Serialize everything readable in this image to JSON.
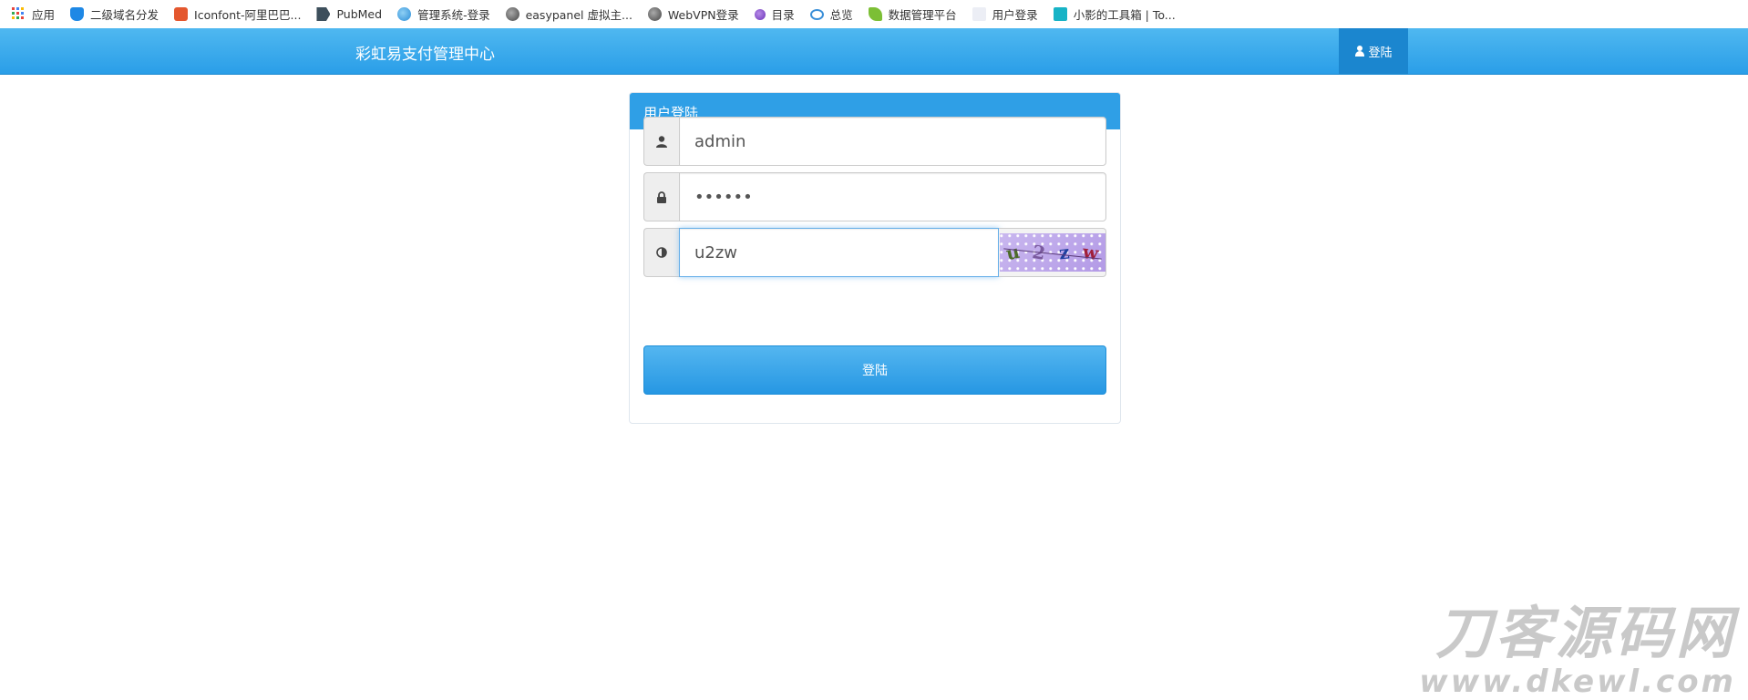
{
  "bookmarks": [
    {
      "label": "应用",
      "icon": "apps-grid-icon"
    },
    {
      "label": "二级域名分发",
      "icon": "shield-icon"
    },
    {
      "label": "Iconfont-阿里巴巴...",
      "icon": "iconfont-icon"
    },
    {
      "label": "PubMed",
      "icon": "pubmed-icon"
    },
    {
      "label": "管理系统-登录",
      "icon": "globe-icon"
    },
    {
      "label": "easypanel 虚拟主...",
      "icon": "globe-icon"
    },
    {
      "label": "WebVPN登录",
      "icon": "globe-icon"
    },
    {
      "label": "目录",
      "icon": "purple-circle-icon"
    },
    {
      "label": "总览",
      "icon": "cloud-icon"
    },
    {
      "label": "数据管理平台",
      "icon": "leaf-icon"
    },
    {
      "label": "用户登录",
      "icon": "blank-page-icon"
    },
    {
      "label": "小影的工具箱 | To...",
      "icon": "toolbox-icon"
    }
  ],
  "navbar": {
    "brand": "彩虹易支付管理中心",
    "login_label": "登陆",
    "login_icon": "user-icon",
    "gradient_top": "#4fb8f0",
    "gradient_bottom": "#2a9ee8"
  },
  "panel": {
    "title": "用户登陆",
    "username": {
      "value": "admin",
      "icon": "user-icon"
    },
    "password": {
      "value": "••••••",
      "icon": "lock-icon"
    },
    "captcha": {
      "value": "u2zw",
      "icon": "half-circle-icon",
      "image_text": "u2zw"
    },
    "submit_label": "登陆",
    "accent": "#2f9fe6"
  },
  "watermark": {
    "title": "刀客源码网",
    "url": "www.dkewl.com"
  }
}
